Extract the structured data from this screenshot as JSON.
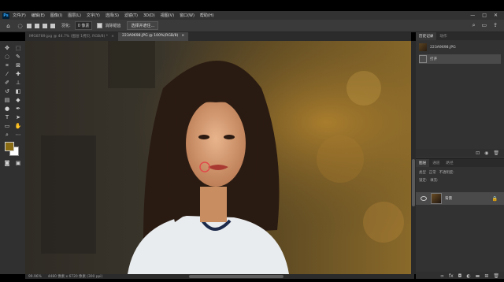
{
  "app": {
    "logo": "Ps"
  },
  "menu": [
    "文件(F)",
    "编辑(E)",
    "图像(I)",
    "图层(L)",
    "文字(Y)",
    "选择(S)",
    "滤镜(T)",
    "3D(D)",
    "视图(V)",
    "窗口(W)",
    "帮助(H)"
  ],
  "window_controls": [
    "—",
    "□",
    "✕"
  ],
  "options": {
    "feather_label": "羽化:",
    "feather_value": "0 像素",
    "antialias_label": "消除锯齿",
    "select_mask_button": "选择并遮住..."
  },
  "tabs": [
    {
      "label": "IMG8789.jpg @ 44.7% (图层 1拷贝, RGB/8) *",
      "active": false
    },
    {
      "label": "223A9698.JPG @ 100%(RGB/8)",
      "active": true
    }
  ],
  "status": {
    "zoom": "99.96%",
    "doc_info": "4480 像素 x 6720 像素 (300 ppi)"
  },
  "history_panel": {
    "tabs": [
      "历史记录",
      "动作"
    ],
    "snapshot": "223A9698.JPG",
    "items": [
      "打开"
    ]
  },
  "layers_panel": {
    "tabs": [
      "图层",
      "通道",
      "路径"
    ],
    "kind_label": "类型",
    "mode_label": "正常",
    "opacity_label": "不透明度:",
    "lock_label": "锁定:",
    "fill_label": "填充:",
    "layer_name": "背景"
  },
  "colors": {
    "foreground": "#8a6c14",
    "background": "#ffffff",
    "ui_dark": "#323232"
  }
}
